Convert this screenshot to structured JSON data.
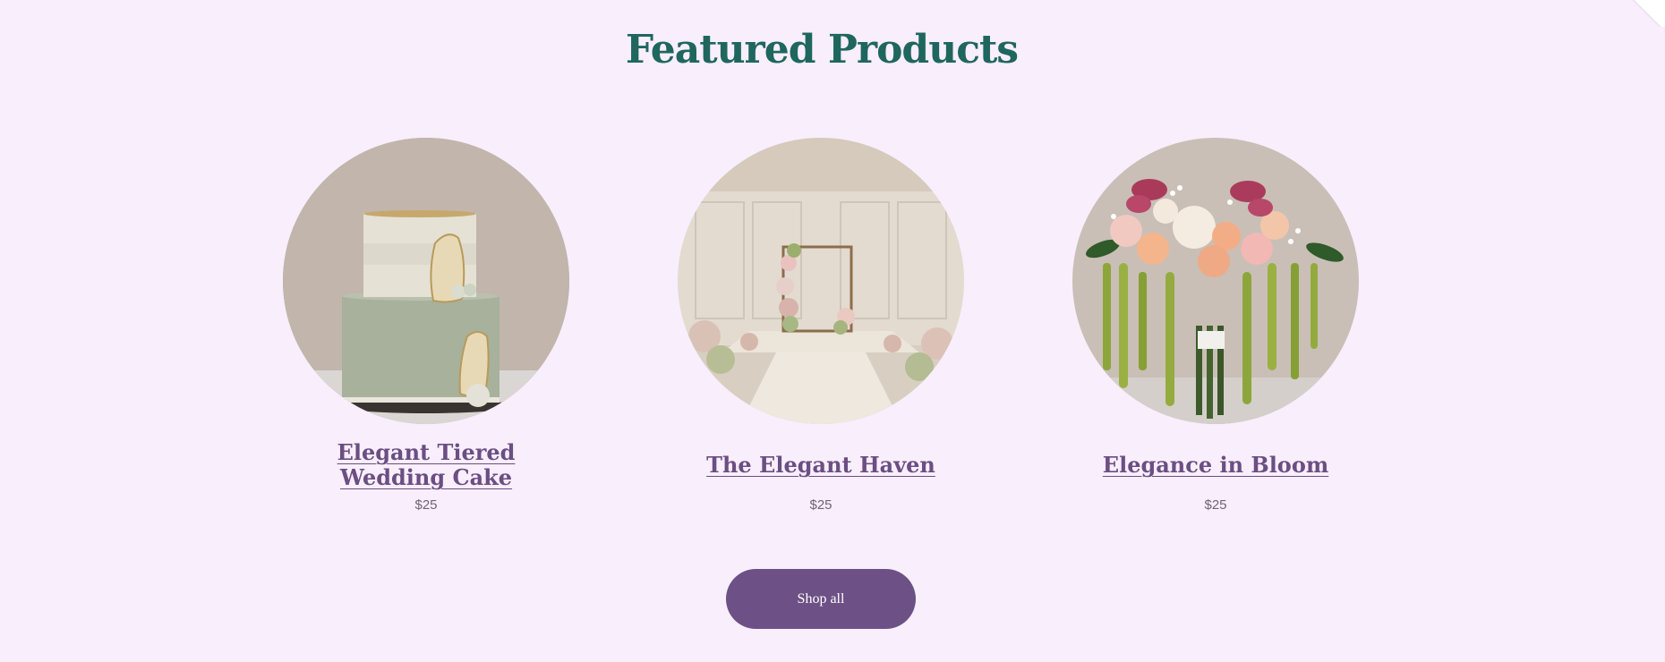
{
  "section": {
    "title": "Featured Products"
  },
  "products": [
    {
      "name": "Elegant Tiered Wedding Cake",
      "price": "$25",
      "image_icon": "wedding-cake-image"
    },
    {
      "name": "The Elegant Haven",
      "price": "$25",
      "image_icon": "ceremony-venue-image"
    },
    {
      "name": "Elegance in Bloom",
      "price": "$25",
      "image_icon": "bouquet-image"
    }
  ],
  "cta": {
    "shop_all_label": "Shop all"
  },
  "colors": {
    "background": "#f8eefc",
    "title": "#1f665f",
    "product_name": "#6b4e82",
    "button": "#6d5085"
  }
}
